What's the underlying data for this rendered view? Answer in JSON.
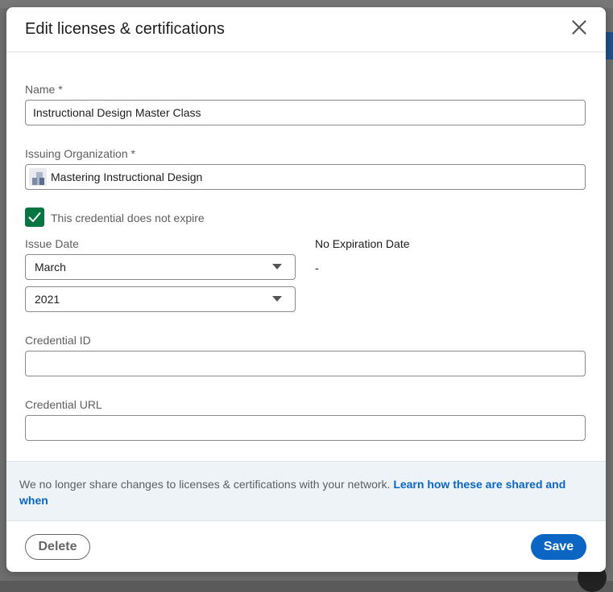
{
  "dialog": {
    "title": "Edit licenses & certifications"
  },
  "form": {
    "name": {
      "label": "Name",
      "required_mark": "*",
      "value": "Instructional Design Master Class"
    },
    "issuing_organization": {
      "label": "Issuing Organization",
      "required_mark": "*",
      "value": "Mastering Instructional Design"
    },
    "no_expire": {
      "checked": true,
      "label": "This credential does not expire"
    },
    "issue_date": {
      "label": "Issue Date",
      "month": "March",
      "year": "2021"
    },
    "expiration": {
      "label": "No Expiration Date",
      "value": "-"
    },
    "credential_id": {
      "label": "Credential ID",
      "value": ""
    },
    "credential_url": {
      "label": "Credential URL",
      "value": ""
    }
  },
  "info_banner": {
    "text": "We no longer share changes to licenses & certifications with your network.",
    "link": "Learn how these are shared and when"
  },
  "footer": {
    "delete_label": "Delete",
    "save_label": "Save"
  },
  "colors": {
    "primary": "#0a66c2",
    "checkbox": "#057642",
    "banner_bg": "#eef3f8"
  }
}
